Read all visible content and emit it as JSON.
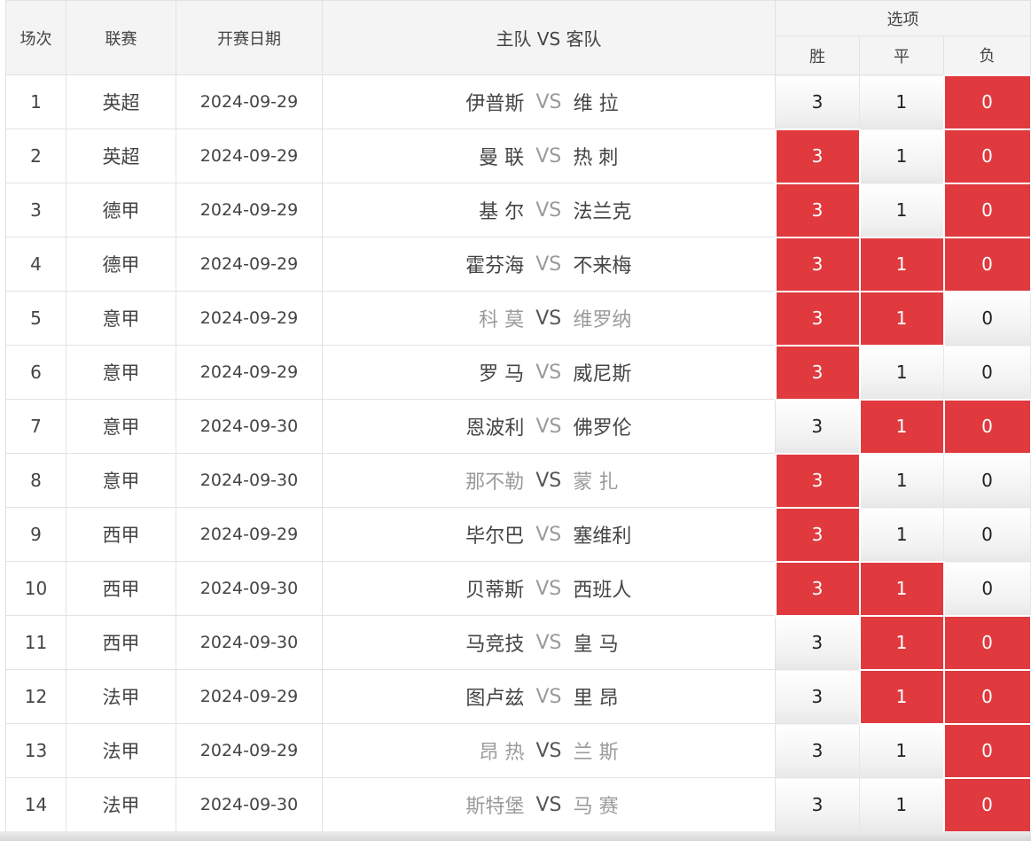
{
  "header": {
    "round": "场次",
    "league": "联赛",
    "date": "开赛日期",
    "match": "主队 VS 客队",
    "options": "选项",
    "win": "胜",
    "draw": "平",
    "loss": "负"
  },
  "vs_label": "VS",
  "option_values": {
    "win": "3",
    "draw": "1",
    "loss": "0"
  },
  "colors": {
    "selected": "#e03a3f",
    "header_bg": "#f4f4f4",
    "muted_text": "#9b9b9b"
  },
  "rows": [
    {
      "no": "1",
      "league": "英超",
      "date": "2024-09-29",
      "home": "伊普斯",
      "away": "维 拉",
      "muted": "none",
      "selected": [
        "loss"
      ]
    },
    {
      "no": "2",
      "league": "英超",
      "date": "2024-09-29",
      "home": "曼 联",
      "away": "热 刺",
      "muted": "none",
      "selected": [
        "win",
        "loss"
      ]
    },
    {
      "no": "3",
      "league": "德甲",
      "date": "2024-09-29",
      "home": "基 尔",
      "away": "法兰克",
      "muted": "none",
      "selected": [
        "win",
        "loss"
      ]
    },
    {
      "no": "4",
      "league": "德甲",
      "date": "2024-09-29",
      "home": "霍芬海",
      "away": "不来梅",
      "muted": "none",
      "selected": [
        "win",
        "draw",
        "loss"
      ]
    },
    {
      "no": "5",
      "league": "意甲",
      "date": "2024-09-29",
      "home": "科 莫",
      "away": "维罗纳",
      "muted": "both",
      "selected": [
        "win",
        "draw"
      ]
    },
    {
      "no": "6",
      "league": "意甲",
      "date": "2024-09-29",
      "home": "罗 马",
      "away": "威尼斯",
      "muted": "none",
      "selected": [
        "win"
      ]
    },
    {
      "no": "7",
      "league": "意甲",
      "date": "2024-09-30",
      "home": "恩波利",
      "away": "佛罗伦",
      "muted": "none",
      "selected": [
        "draw",
        "loss"
      ]
    },
    {
      "no": "8",
      "league": "意甲",
      "date": "2024-09-30",
      "home": "那不勒",
      "away": "蒙 扎",
      "muted": "both",
      "selected": [
        "win"
      ]
    },
    {
      "no": "9",
      "league": "西甲",
      "date": "2024-09-29",
      "home": "毕尔巴",
      "away": "塞维利",
      "muted": "none",
      "selected": [
        "win"
      ]
    },
    {
      "no": "10",
      "league": "西甲",
      "date": "2024-09-30",
      "home": "贝蒂斯",
      "away": "西班人",
      "muted": "none",
      "selected": [
        "win",
        "draw"
      ]
    },
    {
      "no": "11",
      "league": "西甲",
      "date": "2024-09-30",
      "home": "马竞技",
      "away": "皇 马",
      "muted": "none",
      "selected": [
        "draw",
        "loss"
      ]
    },
    {
      "no": "12",
      "league": "法甲",
      "date": "2024-09-29",
      "home": "图卢兹",
      "away": "里 昂",
      "muted": "none",
      "selected": [
        "draw",
        "loss"
      ]
    },
    {
      "no": "13",
      "league": "法甲",
      "date": "2024-09-29",
      "home": "昂 热",
      "away": "兰 斯",
      "muted": "both",
      "selected": [
        "loss"
      ]
    },
    {
      "no": "14",
      "league": "法甲",
      "date": "2024-09-30",
      "home": "斯特堡",
      "away": "马 赛",
      "muted": "both",
      "selected": [
        "loss"
      ]
    }
  ]
}
